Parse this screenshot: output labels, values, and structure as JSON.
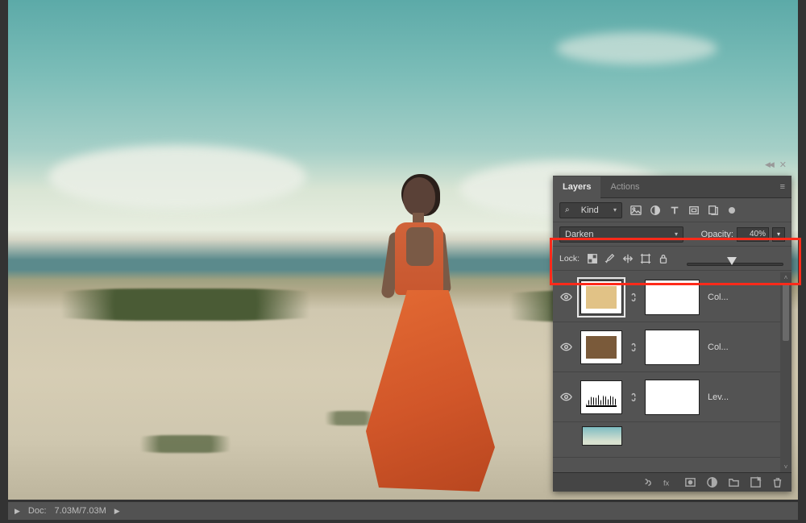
{
  "statusbar": {
    "doc_label": "Doc:",
    "doc_value": "7.03M/7.03M"
  },
  "panel": {
    "tabs": {
      "layers": "Layers",
      "actions": "Actions"
    },
    "filter": {
      "kind_label": "Kind",
      "icons": [
        "image-icon",
        "adjustment-icon",
        "type-icon",
        "shape-icon",
        "smartobject-icon"
      ]
    },
    "blend": {
      "mode": "Darken",
      "opacity_label": "Opacity:",
      "opacity_value": "40%"
    },
    "lock": {
      "label": "Lock:"
    },
    "layers": [
      {
        "name": "Col...",
        "type": "color",
        "swatch": "c1",
        "selected": true
      },
      {
        "name": "Col...",
        "type": "color",
        "swatch": "c2",
        "selected": false
      },
      {
        "name": "Lev...",
        "type": "levels",
        "selected": false
      }
    ]
  }
}
